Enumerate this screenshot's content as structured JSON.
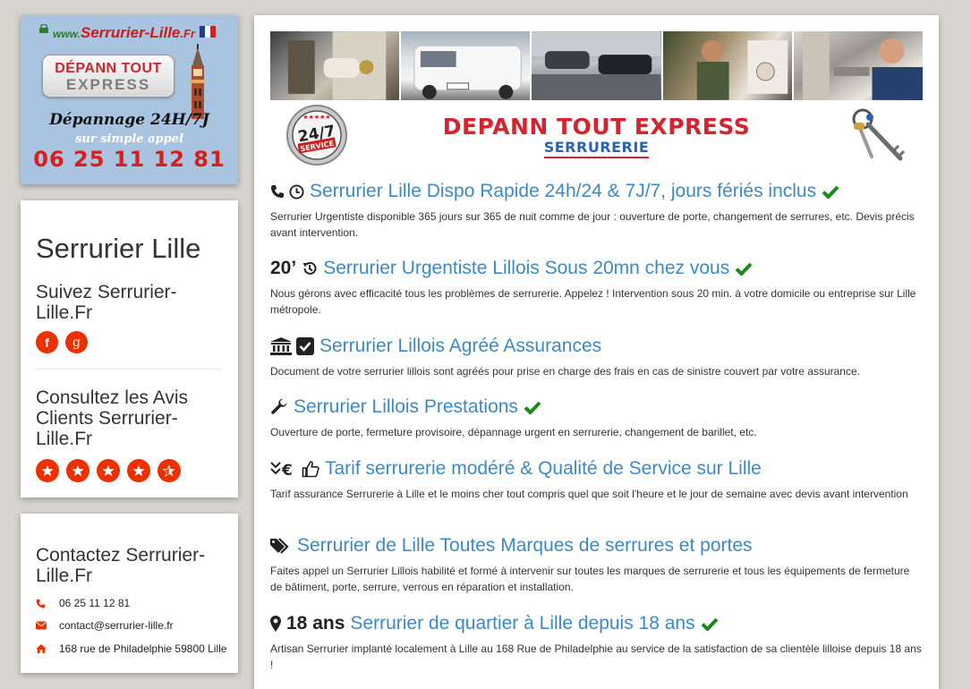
{
  "logo": {
    "url_prefix": "www.",
    "url_name": "Serrurier-Lille",
    "url_tld": ".Fr",
    "brand_line1": "DÉPANN TOUT",
    "brand_line2": "EXPRESS",
    "tagline": "Dépannage 24H/7J",
    "call_line": "sur simple appel",
    "phone": "06 25 11 12 81"
  },
  "sidebar": {
    "title": "Serrurier Lille",
    "follow_heading": "Suivez Serrurier-Lille.Fr",
    "social": [
      {
        "icon": "facebook-icon",
        "glyph": "f"
      },
      {
        "icon": "google-icon",
        "glyph": "g"
      }
    ],
    "reviews_heading": "Consultez les Avis Clients Serrurier-Lille.Fr",
    "rating": 4.5,
    "rating_max": 5
  },
  "contact": {
    "heading": "Contactez Serrurier-Lille.Fr",
    "phone": "06 25 11 12 81",
    "email": "contact@serrurier-lille.fr",
    "address": "168 rue de Philadelphie 59800 Lille"
  },
  "banner": {
    "title": "DEPANN TOUT EXPRESS",
    "subtitle": "SERRURERIE",
    "badge_top": "24/7",
    "badge_bottom": "SERVICE"
  },
  "services": [
    {
      "prefix": "",
      "icons": [
        "phone-icon",
        "clock-icon"
      ],
      "title": "Serrurier Lille Dispo Rapide 24h/24 & 7J/7, jours fériés inclus",
      "check": true,
      "desc": "Serrurier Urgentiste disponible 365 jours sur 365 de nuit comme de jour : ouverture de porte, changement de serrures, etc. Devis précis avant intervention."
    },
    {
      "prefix": "20’",
      "icons": [
        "history-icon"
      ],
      "title": "Serrurier Urgentiste Lillois Sous 20mn chez vous",
      "check": true,
      "desc": "Nous gérons avec efficacité tous les problèmes de serrurerie. Appelez ! Intervention sous 20 min. à votre domicile ou entreprise sur Lille métropole."
    },
    {
      "prefix": "",
      "icons": [
        "bank-icon",
        "check-square-icon"
      ],
      "title": "Serrurier Lillois Agréé Assurances",
      "check": false,
      "desc": "Document de votre serrurier lillois sont agréés pour prise en charge des frais en cas de sinistre couvert par votre assurance."
    },
    {
      "prefix": "",
      "icons": [
        "wrench-icon"
      ],
      "title": "Serrurier Lillois Prestations",
      "check": true,
      "desc": "Ouverture de porte, fermeture provisoire, dépannage urgent en serrurerie, changement de barillet, etc."
    },
    {
      "prefix": "",
      "icons": [
        "down-euro-icon",
        "thumbs-up-icon"
      ],
      "title": "Tarif serrurerie modéré & Qualité de Service sur Lille",
      "check": false,
      "desc": "Tarif assurance Serrurerie à Lille et le moins cher tout compris quel que soit l'heure et le jour de semaine avec devis avant intervention"
    },
    {
      "prefix": "",
      "icons": [
        "tags-icon"
      ],
      "title": "Serrurier de Lille Toutes Marques de serrures et portes",
      "check": false,
      "desc": "Faites appel un Serrurier Lillois habilité et formé à intervenir sur toutes les marques de serrurerie et tous les équipements de fermeture de bâtiment, porte, serrure, verrous en réparation et installation."
    },
    {
      "prefix": "18 ans",
      "icons": [
        "map-marker-icon"
      ],
      "title": "Serrurier de quartier à Lille depuis 18 ans",
      "check": true,
      "desc": "Artisan Serrurier implanté localement à Lille au 168 Rue de Philadelphie au service de la satisfaction de sa clientèle lilloise depuis 18 ans !"
    }
  ],
  "colors": {
    "accent_red": "#ee3000",
    "link_blue": "#3b8ac4",
    "check_green": "#1a8a1a",
    "brand_red": "#d32430",
    "brand_blue": "#2a62b3"
  }
}
